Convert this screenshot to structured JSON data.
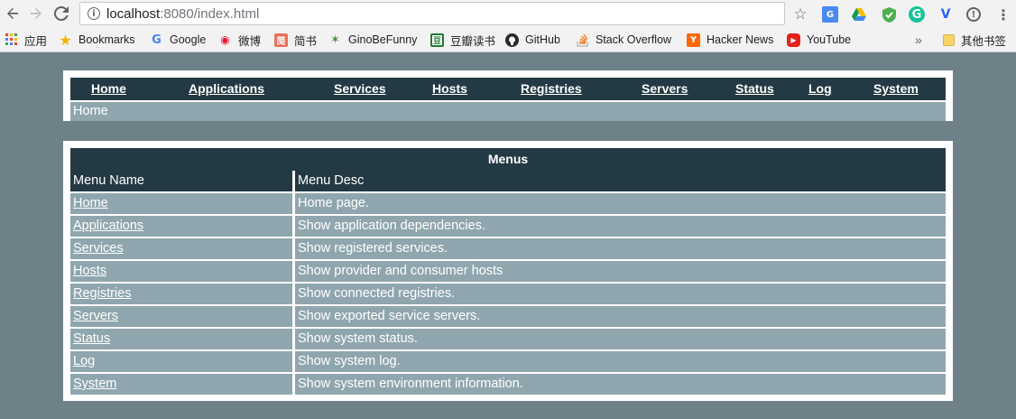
{
  "browser": {
    "url_host": "localhost",
    "url_rest": ":8080/index.html",
    "icons": {
      "back": "back-arrow-icon",
      "forward": "forward-arrow-icon",
      "reload": "reload-icon",
      "info": "info-icon",
      "star": "star-icon",
      "menu": "kebab-menu-icon"
    }
  },
  "bookmarks": [
    {
      "label": "应用",
      "icon": "apps-grid-icon"
    },
    {
      "label": "Bookmarks",
      "icon": "star-icon"
    },
    {
      "label": "Google",
      "icon": "google-icon"
    },
    {
      "label": "微博",
      "icon": "weibo-icon"
    },
    {
      "label": "简书",
      "icon": "jianshu-icon"
    },
    {
      "label": "GinoBeFunny",
      "icon": "ginobefunny-icon"
    },
    {
      "label": "豆瓣读书",
      "icon": "douban-icon"
    },
    {
      "label": "GitHub",
      "icon": "github-icon"
    },
    {
      "label": "Stack Overflow",
      "icon": "stackoverflow-icon"
    },
    {
      "label": "Hacker News",
      "icon": "hackernews-icon"
    },
    {
      "label": "YouTube",
      "icon": "youtube-icon"
    }
  ],
  "bookmarks_overflow": "»",
  "other_bookmarks": "其他书签",
  "nav": [
    "Home",
    "Applications",
    "Services",
    "Hosts",
    "Registries",
    "Servers",
    "Status",
    "Log",
    "System"
  ],
  "breadcrumb": "Home",
  "menus": {
    "caption": "Menus",
    "headers": [
      "Menu Name",
      "Menu Desc"
    ],
    "rows": [
      {
        "name": "Home",
        "desc": "Home page."
      },
      {
        "name": "Applications",
        "desc": "Show application dependencies."
      },
      {
        "name": "Services",
        "desc": "Show registered services."
      },
      {
        "name": "Hosts",
        "desc": "Show provider and consumer hosts"
      },
      {
        "name": "Registries",
        "desc": "Show connected registries."
      },
      {
        "name": "Servers",
        "desc": "Show exported service servers."
      },
      {
        "name": "Status",
        "desc": "Show system status."
      },
      {
        "name": "Log",
        "desc": "Show system log."
      },
      {
        "name": "System",
        "desc": "Show system environment information."
      }
    ]
  },
  "colors": {
    "page_bg": "#6e8088",
    "header_bg": "#233a44",
    "cell_bg": "#8fa6ae",
    "text": "#ffffff"
  }
}
